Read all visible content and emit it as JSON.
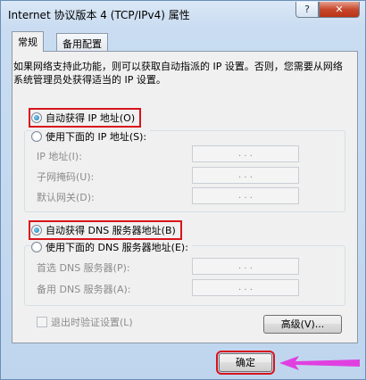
{
  "window": {
    "title": "Internet 协议版本 4 (TCP/IPv4) 属性",
    "help_label": "?",
    "close_label": "✕"
  },
  "tabs": [
    {
      "label": "常规"
    },
    {
      "label": "备用配置"
    }
  ],
  "description": "如果网络支持此功能，则可以获取自动指派的 IP 设置。否则，您需要从网络系统管理员处获得适当的 IP 设置。",
  "ip_section": {
    "auto_radio": {
      "label": "自动获得 IP 地址(O)",
      "checked": true
    },
    "manual_radio": {
      "label": "使用下面的 IP 地址(S):",
      "checked": false
    },
    "fields": [
      {
        "label": "IP 地址(I):",
        "value": ".   .   ."
      },
      {
        "label": "子网掩码(U):",
        "value": ".   .   ."
      },
      {
        "label": "默认网关(D):",
        "value": ".   .   ."
      }
    ]
  },
  "dns_section": {
    "auto_radio": {
      "label": "自动获得 DNS 服务器地址(B)",
      "checked": true
    },
    "manual_radio": {
      "label": "使用下面的 DNS 服务器地址(E):",
      "checked": false
    },
    "fields": [
      {
        "label": "首选 DNS 服务器(P):",
        "value": ".   .   ."
      },
      {
        "label": "备用 DNS 服务器(A):",
        "value": ".   .   ."
      }
    ]
  },
  "validate_checkbox": {
    "label": "退出时验证设置(L)",
    "checked": false
  },
  "advanced_button": {
    "label": "高级(V)..."
  },
  "ok_button": {
    "label": "确定"
  },
  "colors": {
    "highlight": "#d9131b",
    "arrow": "#e040e0"
  }
}
